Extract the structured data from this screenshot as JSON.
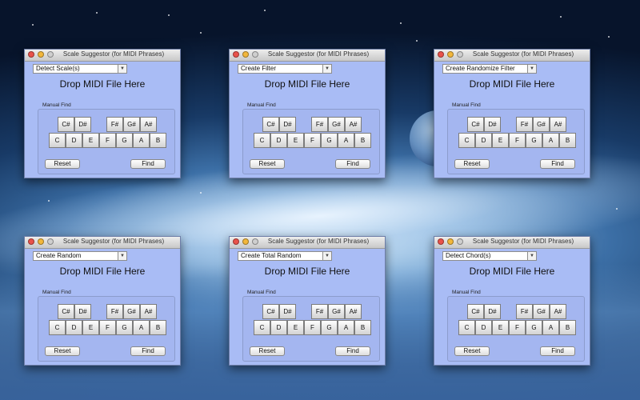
{
  "window_title": "Scale Suggestor (for MIDI Phrases)",
  "drop_label": "Drop MIDI File Here",
  "manual_find_label": "Manual Find",
  "reset_label": "Reset",
  "find_label": "Find",
  "black_keys": [
    "C#",
    "D#",
    "F#",
    "G#",
    "A#"
  ],
  "white_keys": [
    "C",
    "D",
    "E",
    "F",
    "G",
    "A",
    "B"
  ],
  "windows": [
    {
      "mode": "Detect Scale(s)"
    },
    {
      "mode": "Create Filter"
    },
    {
      "mode": "Create Randomize Filter"
    },
    {
      "mode": "Create Random"
    },
    {
      "mode": "Create Total Random"
    },
    {
      "mode": "Detect Chord(s)"
    }
  ],
  "colors": {
    "window_bg": "#a9bcf5",
    "close_light": "#e9524a",
    "minimize_light": "#f2b73b",
    "zoom_light": "#cfcfcf"
  }
}
